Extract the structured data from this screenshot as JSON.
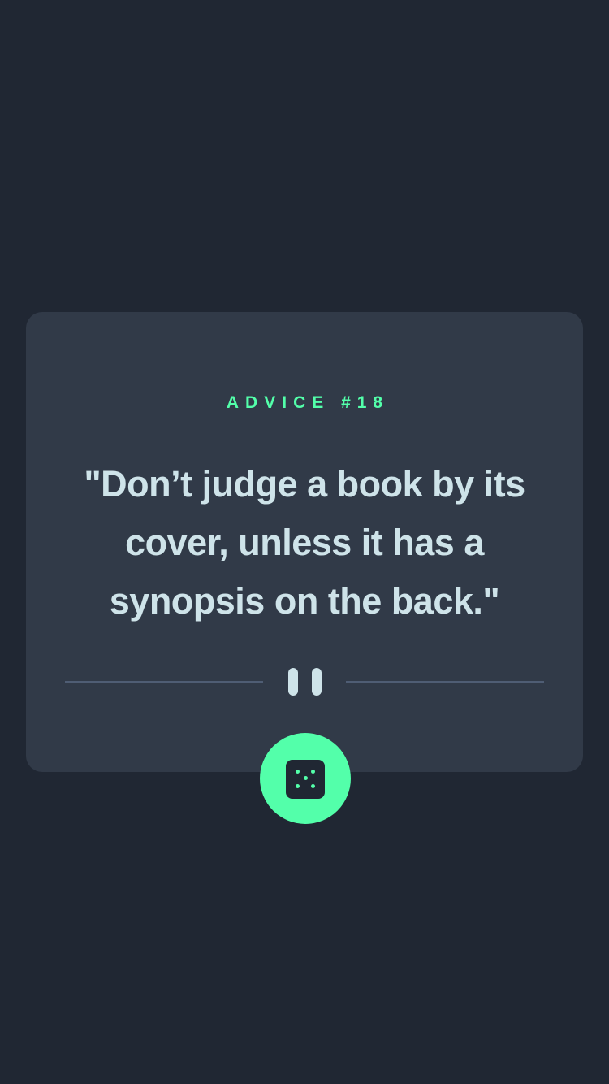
{
  "advice": {
    "label": "ADVICE #18",
    "quote": "\"Don’t judge a book by its cover, unless it has a synopsis on the back.\""
  },
  "icons": {
    "divider": "pause-icon",
    "button": "dice-icon"
  },
  "colors": {
    "background": "#202733",
    "card": "#313A48",
    "accent": "#53FFAA",
    "text": "#CEE3E9",
    "divider": "#4F5D74"
  }
}
